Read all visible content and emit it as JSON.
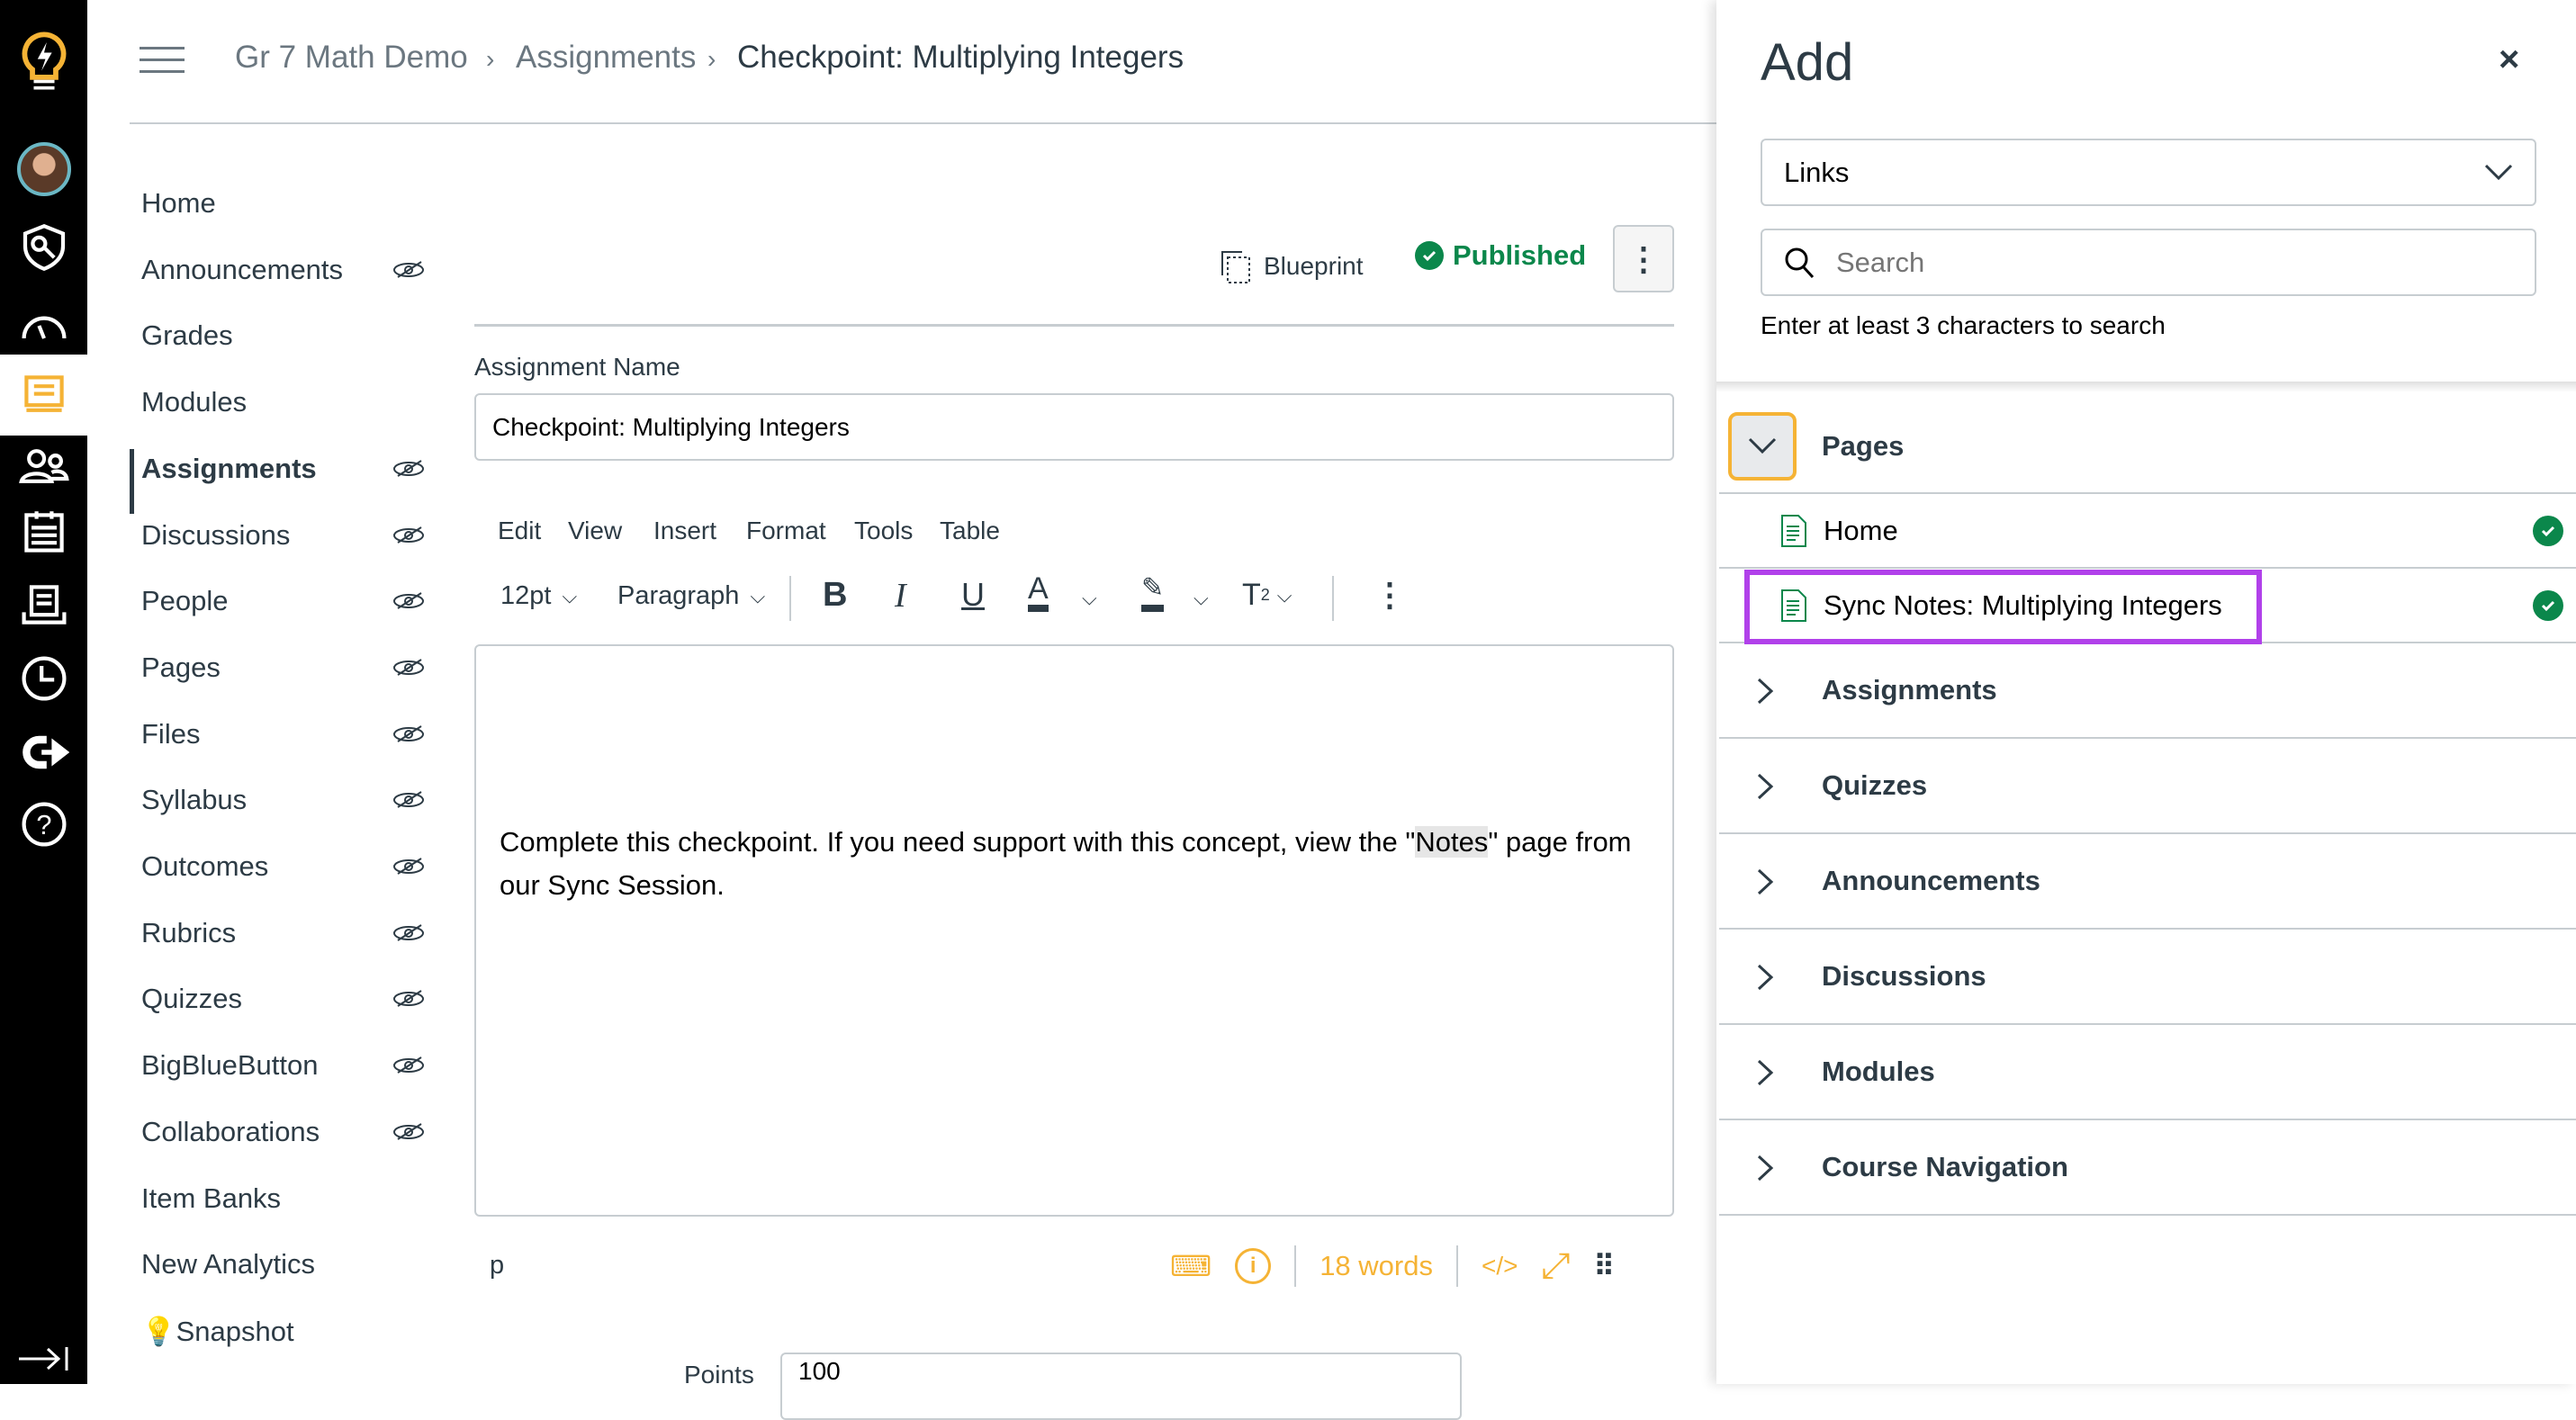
{
  "global_nav": {
    "items": [
      "logo-icon",
      "account-avatar",
      "admin-icon",
      "dashboard-icon",
      "courses-icon",
      "groups-icon",
      "calendar-icon",
      "inbox-icon",
      "history-icon",
      "commons-icon",
      "help-icon"
    ],
    "collapse": "collapse-icon"
  },
  "breadcrumb": [
    "Gr 7 Math Demo",
    "Assignments",
    "Checkpoint: Multiplying Integers"
  ],
  "course_nav": [
    {
      "label": "Home",
      "hidden": false
    },
    {
      "label": "Announcements",
      "hidden": true
    },
    {
      "label": "Grades",
      "hidden": false
    },
    {
      "label": "Modules",
      "hidden": false
    },
    {
      "label": "Assignments",
      "hidden": true,
      "active": true
    },
    {
      "label": "Discussions",
      "hidden": true
    },
    {
      "label": "People",
      "hidden": true
    },
    {
      "label": "Pages",
      "hidden": true
    },
    {
      "label": "Files",
      "hidden": true
    },
    {
      "label": "Syllabus",
      "hidden": true
    },
    {
      "label": "Outcomes",
      "hidden": true
    },
    {
      "label": "Rubrics",
      "hidden": true
    },
    {
      "label": "Quizzes",
      "hidden": true
    },
    {
      "label": "BigBlueButton",
      "hidden": true
    },
    {
      "label": "Collaborations",
      "hidden": true
    },
    {
      "label": "Item Banks",
      "hidden": false
    },
    {
      "label": "New Analytics",
      "hidden": false
    },
    {
      "label": "Snapshot",
      "hidden": false
    }
  ],
  "header": {
    "blueprint": "Blueprint",
    "published": "Published"
  },
  "form": {
    "name_label": "Assignment Name",
    "name_value": "Checkpoint: Multiplying Integers",
    "points_label": "Points",
    "points_value": "100"
  },
  "editor": {
    "menu": [
      "Edit",
      "View",
      "Insert",
      "Format",
      "Tools",
      "Table"
    ],
    "font_size": "12pt",
    "block": "Paragraph",
    "text_before": "Complete this checkpoint. If you need support with this concept, view the \"",
    "text_highlight": "Notes",
    "text_after": "\" page from our Sync Session.",
    "path": "p",
    "word_count": "18 words",
    "html_toggle": "</>"
  },
  "panel": {
    "title": "Add",
    "type_select": "Links",
    "search_placeholder": "Search",
    "hint": "Enter at least 3 characters to search",
    "expanded_section": "Pages",
    "pages": [
      {
        "label": "Home",
        "published": true
      },
      {
        "label": "Sync Notes: Multiplying Integers",
        "published": true,
        "highlighted": true
      }
    ],
    "sections": [
      "Assignments",
      "Quizzes",
      "Announcements",
      "Discussions",
      "Modules",
      "Course Navigation"
    ]
  },
  "colors": {
    "accent": "#f5b335",
    "published": "#0b874b",
    "highlight": "#b141ea",
    "nav_bg": "#000000"
  }
}
